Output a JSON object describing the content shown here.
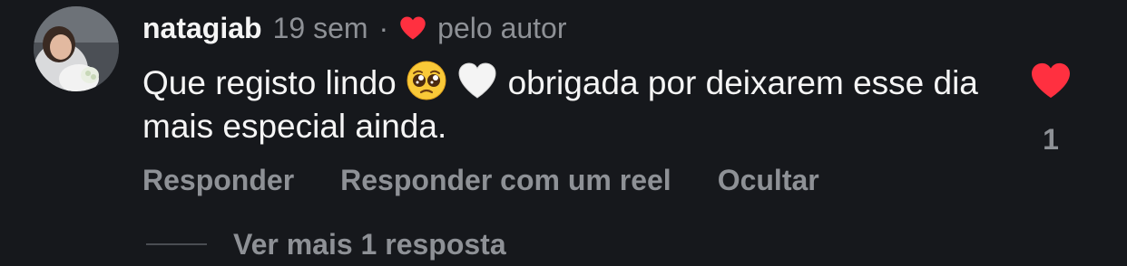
{
  "comment": {
    "username": "natagiab",
    "timestamp": "19 sem",
    "separator": "·",
    "liked_by_author_label": "pelo autor",
    "text_part1": "Que registo lindo ",
    "text_part2": " obrigada por deixarem esse dia mais especial ainda.",
    "emojis": [
      "pleading-face",
      "white-heart"
    ],
    "like_count": "1"
  },
  "actions": {
    "reply": "Responder",
    "reply_with_reel": "Responder com um reel",
    "hide": "Ocultar"
  },
  "replies": {
    "view_more": "Ver mais 1 resposta"
  },
  "colors": {
    "background": "#16181c",
    "text_primary": "#f5f5f5",
    "text_secondary": "#8e9196",
    "heart_red": "#ff3040"
  }
}
